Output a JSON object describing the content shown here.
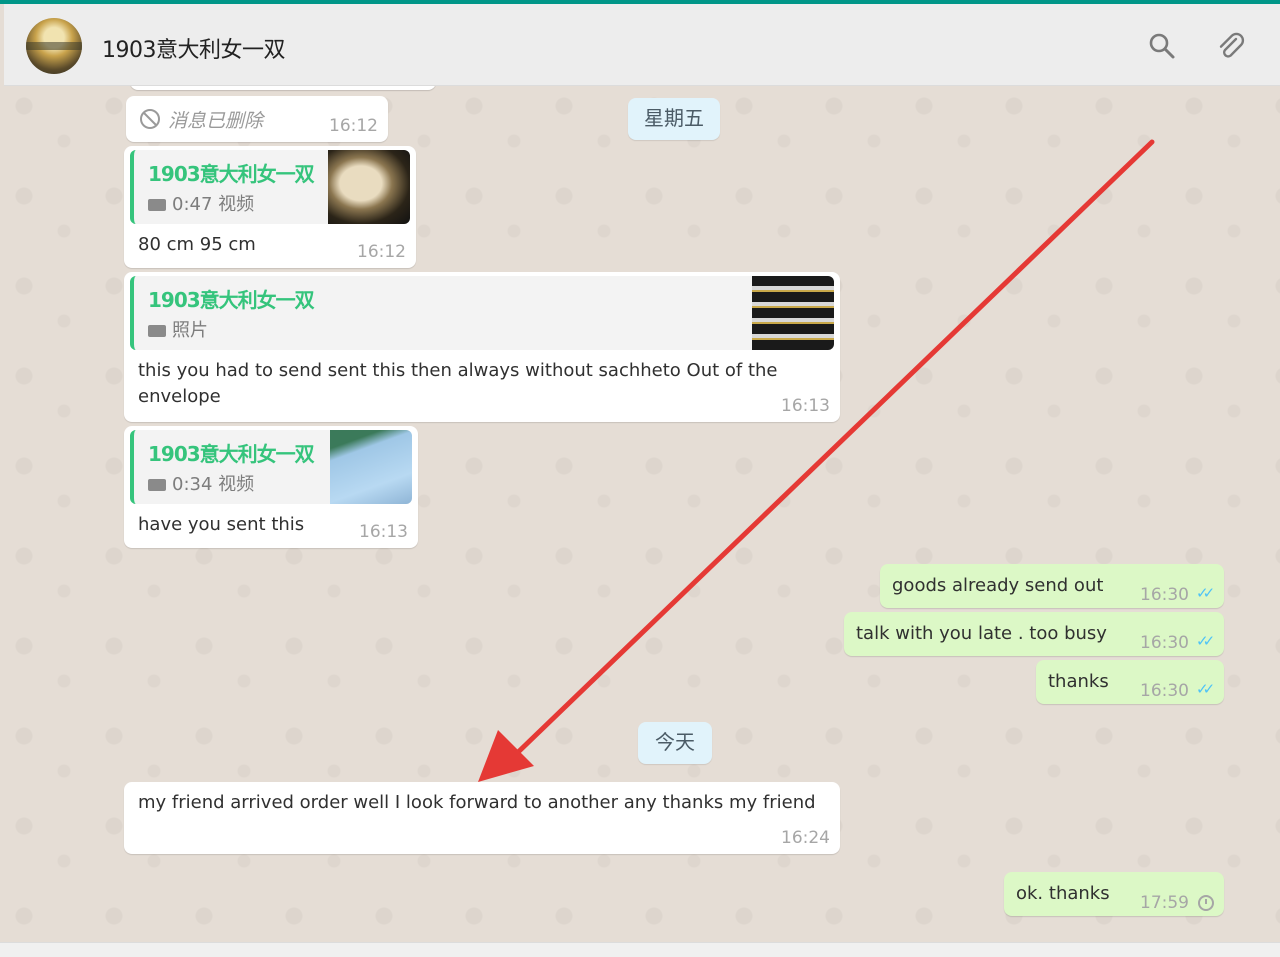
{
  "header": {
    "title": "1903意大利女一双",
    "search_icon": "search-icon",
    "attach_icon": "paperclip-icon"
  },
  "messages": {
    "deleted": {
      "text": "消息已删除",
      "time": "16:12"
    },
    "m1": {
      "quote_name": "1903意大利女一双",
      "quote_meta": "0:47 视频",
      "text": "80 cm 95 cm",
      "time": "16:12"
    },
    "m2": {
      "quote_name": "1903意大利女一双",
      "quote_meta": "照片",
      "text": "this you had to send sent this then always without sachheto Out of the envelope",
      "time": "16:13"
    },
    "m3": {
      "quote_name": "1903意大利女一双",
      "quote_meta": "0:34 视频",
      "text": "have you sent this",
      "time": "16:13"
    },
    "o1": {
      "text": "goods already send out",
      "time": "16:30"
    },
    "o2": {
      "text": "talk with you late . too busy",
      "time": "16:30"
    },
    "o3": {
      "text": "thanks",
      "time": "16:30"
    },
    "m4": {
      "text": "my friend arrived order well I look forward to another any thanks my friend",
      "time": "16:24"
    },
    "o4": {
      "text": "ok. thanks",
      "time": "17:59"
    }
  },
  "dates": {
    "friday": "星期五",
    "today": "今天"
  },
  "colors": {
    "accent": "#009688",
    "incoming": "#ffffff",
    "outgoing": "#dcf8c6",
    "quote_name": "#35c47c",
    "arrow": "#e53935"
  }
}
